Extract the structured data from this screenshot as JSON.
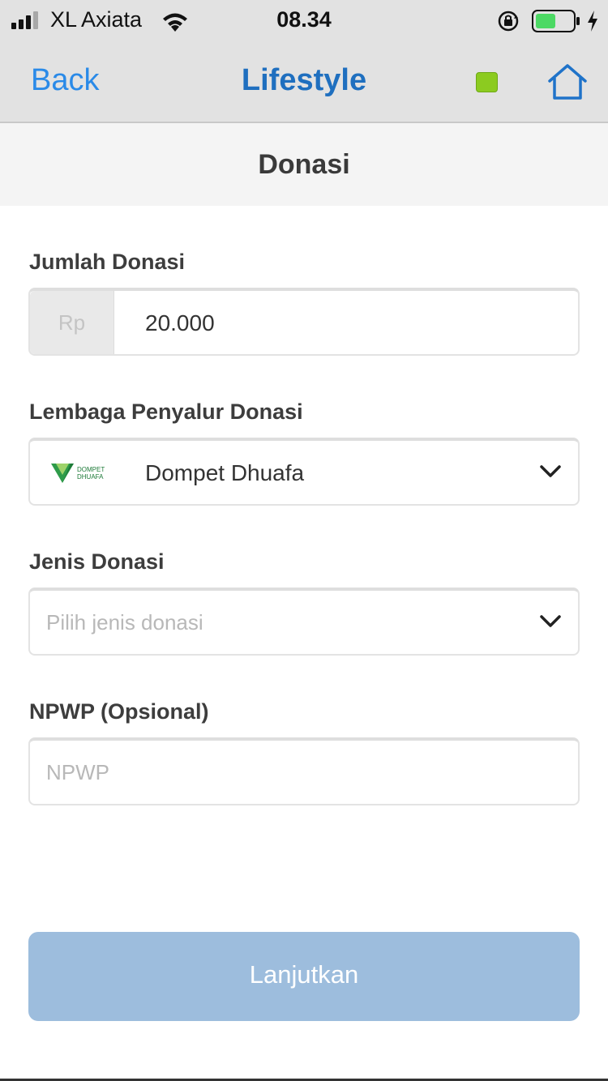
{
  "status_bar": {
    "carrier": "XL Axiata",
    "time": "08.34",
    "battery_color": "#4cd964"
  },
  "nav": {
    "back_label": "Back",
    "title": "Lifestyle",
    "indicator_color": "#8ccb20",
    "home_icon": "home-icon"
  },
  "section": {
    "title": "Donasi"
  },
  "form": {
    "amount": {
      "label": "Jumlah Donasi",
      "prefix": "Rp",
      "value": "20.000"
    },
    "institution": {
      "label": "Lembaga Penyalur Donasi",
      "logo_text_1": "DOMPET",
      "logo_text_2": "DHUAFA",
      "value": "Dompet Dhuafa"
    },
    "type": {
      "label": "Jenis Donasi",
      "placeholder": "Pilih jenis donasi"
    },
    "npwp": {
      "label": "NPWP (Opsional)",
      "placeholder": "NPWP"
    }
  },
  "submit": {
    "label": "Lanjutkan",
    "color": "#9dbddd"
  }
}
